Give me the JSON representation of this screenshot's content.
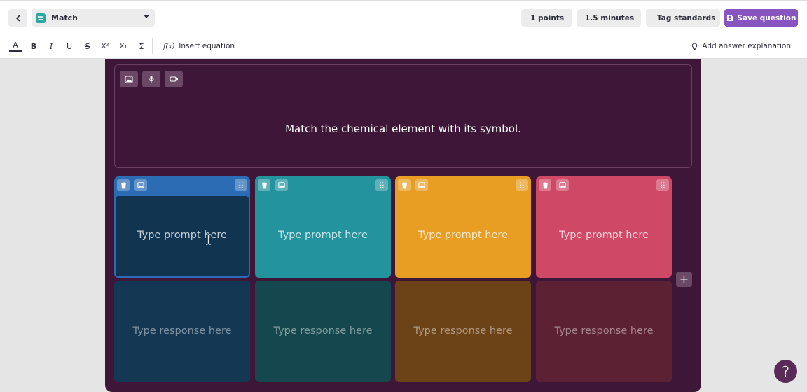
{
  "header": {
    "question_type": "Match",
    "points": "1 points",
    "time": "1.5 minutes",
    "tag_standards": "Tag standards",
    "save_question": "Save question"
  },
  "toolbar": {
    "text_color": "A",
    "bold": "B",
    "italic": "I",
    "underline": "U",
    "strikethrough": "S",
    "superscript": "X²",
    "subscript": "X₁",
    "symbols": "Σ",
    "insert_equation_icon": "f(x)",
    "insert_equation": "Insert equation",
    "add_answer_explanation": "Add answer explanation"
  },
  "question": {
    "text": "Match the chemical element with its symbol."
  },
  "pairs": [
    {
      "prompt_placeholder": "Type prompt here",
      "response_placeholder": "Type response here",
      "color": "#2b6cb4",
      "response_color": "#143753"
    },
    {
      "prompt_placeholder": "Type prompt here",
      "response_placeholder": "Type response here",
      "color": "#23939e",
      "response_color": "#15484e"
    },
    {
      "prompt_placeholder": "Type prompt here",
      "response_placeholder": "Type response here",
      "color": "#e89d23",
      "response_color": "#6b4317"
    },
    {
      "prompt_placeholder": "Type prompt here",
      "response_placeholder": "Type response here",
      "color": "#cf4865",
      "response_color": "#5c2133"
    }
  ],
  "add_column": "+",
  "help": "?",
  "colors": {
    "editor_bg": "#3e1738",
    "accent": "#8854c0"
  },
  "icons": {
    "back": "chevron-left-icon",
    "type": "match-type-icon",
    "points": "check-icon",
    "time": "clock-icon",
    "tag": "tag-icon",
    "save": "save-icon",
    "image": "image-icon",
    "audio": "microphone-icon",
    "video": "video-icon",
    "delete": "trash-icon",
    "drag": "drag-handle-icon",
    "explanation": "lightbulb-icon"
  }
}
